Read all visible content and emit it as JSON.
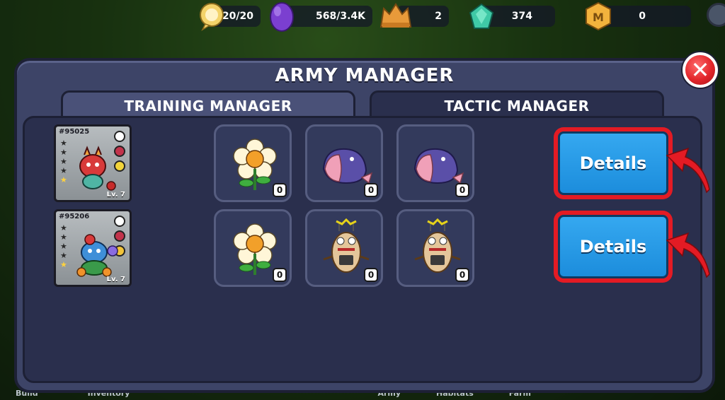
{
  "resources": {
    "energy": "20/20",
    "eggs": "568/3.4K",
    "army_count": "2",
    "gems": "374",
    "coins": "0"
  },
  "panel": {
    "title": "ARMY MANAGER",
    "close_icon": "close-icon"
  },
  "tabs": [
    {
      "label": "TRAINING MANAGER",
      "active": false
    },
    {
      "label": "TACTIC MANAGER",
      "active": true
    }
  ],
  "armies": [
    {
      "id": "#95025",
      "level": "Lv. 7",
      "stars_total": 5,
      "stars_filled": 1,
      "side_icons": [
        "moon-icon",
        "potion-icon",
        "mood-icon"
      ],
      "slots": [
        {
          "unit": "flower-unit",
          "count": "0"
        },
        {
          "unit": "whale-unit",
          "count": "0"
        },
        {
          "unit": "whale-unit",
          "count": "0"
        }
      ],
      "details_label": "Details"
    },
    {
      "id": "#95206",
      "level": "Lv. 7",
      "stars_total": 5,
      "stars_filled": 1,
      "side_icons": [
        "paw-icon",
        "potion-icon",
        "mood-icon"
      ],
      "slots": [
        {
          "unit": "flower-unit",
          "count": "0"
        },
        {
          "unit": "robot-unit",
          "count": "0"
        },
        {
          "unit": "robot-unit",
          "count": "0"
        }
      ],
      "details_label": "Details"
    }
  ],
  "bottom_nav": [
    "Build",
    "Inventory",
    "Army",
    "Habitats",
    "Farm"
  ],
  "colors": {
    "panel_bg": "#3d4467",
    "content_bg": "#2a2f4d",
    "details_blue": "#1c8ddc",
    "highlight_red": "#e31b24",
    "close_red": "#e2262b"
  }
}
